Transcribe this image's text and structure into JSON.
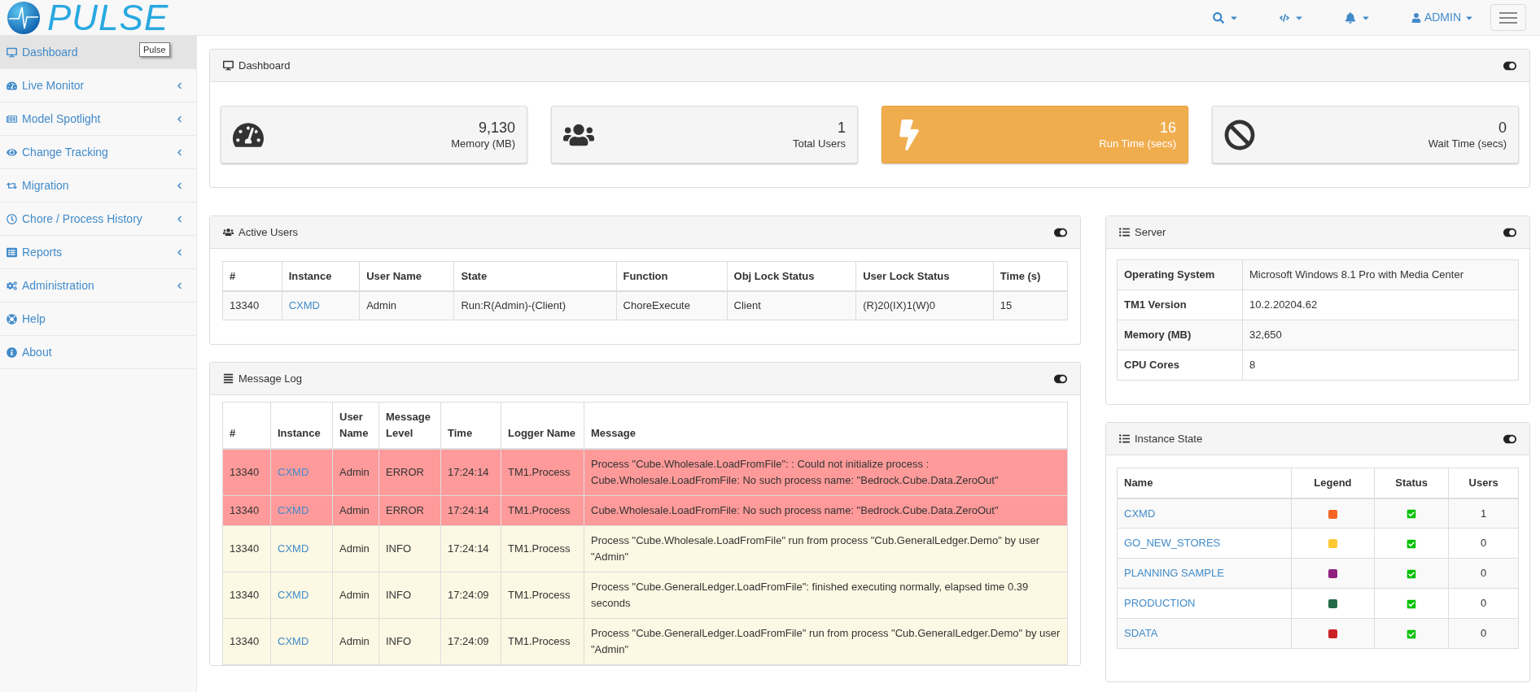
{
  "brand": {
    "name": "PULSE",
    "tooltip": "Pulse"
  },
  "topbar": {
    "user": "ADMIN"
  },
  "sidebar": {
    "items": [
      {
        "label": "Dashboard",
        "selected": true,
        "expandable": false
      },
      {
        "label": "Live Monitor",
        "selected": false,
        "expandable": true
      },
      {
        "label": "Model Spotlight",
        "selected": false,
        "expandable": true
      },
      {
        "label": "Change Tracking",
        "selected": false,
        "expandable": true
      },
      {
        "label": "Migration",
        "selected": false,
        "expandable": true
      },
      {
        "label": "Chore / Process History",
        "selected": false,
        "expandable": true
      },
      {
        "label": "Reports",
        "selected": false,
        "expandable": true
      },
      {
        "label": "Administration",
        "selected": false,
        "expandable": true
      },
      {
        "label": "Help",
        "selected": false,
        "expandable": false
      },
      {
        "label": "About",
        "selected": false,
        "expandable": false
      }
    ]
  },
  "dashboard": {
    "title": "Dashboard",
    "cards": [
      {
        "value": "9,130",
        "label": "Memory (MB)",
        "highlight": false
      },
      {
        "value": "1",
        "label": "Total Users",
        "highlight": false
      },
      {
        "value": "16",
        "label": "Run Time (secs)",
        "highlight": true
      },
      {
        "value": "0",
        "label": "Wait Time (secs)",
        "highlight": false
      }
    ]
  },
  "active_users": {
    "title": "Active Users",
    "columns": [
      "#",
      "Instance",
      "User Name",
      "State",
      "Function",
      "Obj Lock Status",
      "User Lock Status",
      "Time (s)"
    ],
    "rows": [
      [
        "13340",
        "CXMD",
        "Admin",
        "Run:R(Admin)-(Client)",
        "ChoreExecute",
        "Client",
        "(R)20(IX)1(W)0",
        "15"
      ]
    ]
  },
  "message_log": {
    "title": "Message Log",
    "columns": [
      "#",
      "Instance",
      "User Name",
      "Message Level",
      "Time",
      "Logger Name",
      "Message"
    ],
    "rows": [
      {
        "kind": "error",
        "cells": [
          "13340",
          "CXMD",
          "Admin",
          "ERROR",
          "17:24:14",
          "TM1.Process",
          "Process \"Cube.Wholesale.LoadFromFile\": : Could not initialize process : Cube.Wholesale.LoadFromFile: No such process name: \"Bedrock.Cube.Data.ZeroOut\""
        ]
      },
      {
        "kind": "error",
        "cells": [
          "13340",
          "CXMD",
          "Admin",
          "ERROR",
          "17:24:14",
          "TM1.Process",
          "Cube.Wholesale.LoadFromFile: No such process name: \"Bedrock.Cube.Data.ZeroOut\""
        ]
      },
      {
        "kind": "info",
        "cells": [
          "13340",
          "CXMD",
          "Admin",
          "INFO",
          "17:24:14",
          "TM1.Process",
          "Process \"Cube.Wholesale.LoadFromFile\" run from process \"Cub.GeneralLedger.Demo\" by user \"Admin\""
        ]
      },
      {
        "kind": "info",
        "cells": [
          "13340",
          "CXMD",
          "Admin",
          "INFO",
          "17:24:09",
          "TM1.Process",
          "Process \"Cube.GeneralLedger.LoadFromFile\": finished executing normally, elapsed time 0.39 seconds"
        ]
      },
      {
        "kind": "info",
        "cells": [
          "13340",
          "CXMD",
          "Admin",
          "INFO",
          "17:24:09",
          "TM1.Process",
          "Process \"Cube.GeneralLedger.LoadFromFile\" run from process \"Cub.GeneralLedger.Demo\" by user \"Admin\""
        ]
      }
    ]
  },
  "server": {
    "title": "Server",
    "rows": [
      {
        "label": "Operating System",
        "value": "Microsoft Windows 8.1 Pro with Media Center"
      },
      {
        "label": "TM1 Version",
        "value": "10.2.20204.62"
      },
      {
        "label": "Memory (MB)",
        "value": "32,650"
      },
      {
        "label": "CPU Cores",
        "value": "8"
      }
    ]
  },
  "instance_state": {
    "title": "Instance State",
    "columns": [
      "Name",
      "Legend",
      "Status",
      "Users"
    ],
    "rows": [
      {
        "name": "CXMD",
        "color": "#f26522",
        "checked": true,
        "users": "1"
      },
      {
        "name": "GO_NEW_STORES",
        "color": "#ffc933",
        "checked": true,
        "users": "0"
      },
      {
        "name": "PLANNING SAMPLE",
        "color": "#92207e",
        "checked": true,
        "users": "0"
      },
      {
        "name": "PRODUCTION",
        "color": "#236b47",
        "checked": true,
        "users": "0"
      },
      {
        "name": "SDATA",
        "color": "#cc2127",
        "checked": true,
        "users": "0"
      }
    ]
  }
}
